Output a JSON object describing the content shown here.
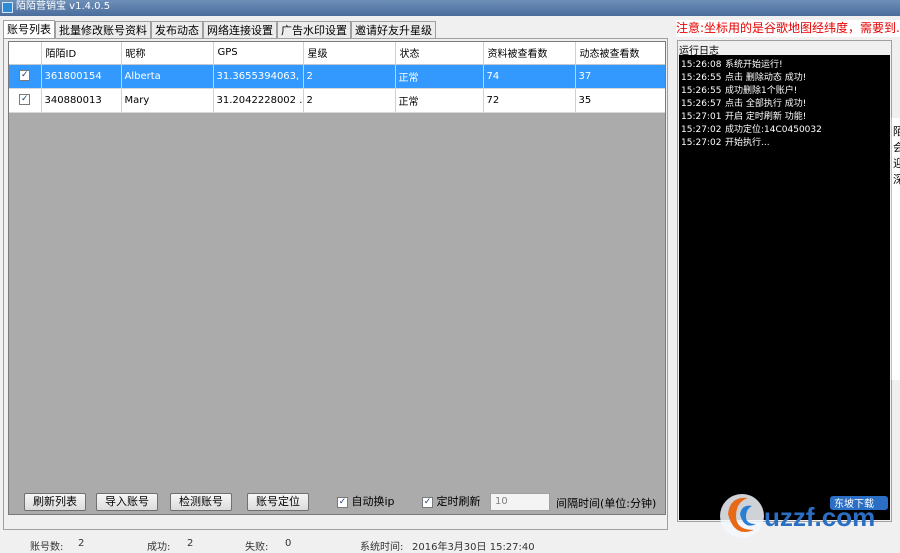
{
  "window": {
    "title": "陌陌营销宝 v1.4.0.5"
  },
  "tabs": [
    "账号列表",
    "批量修改账号资料",
    "发布动态",
    "网络连接设置",
    "广告水印设置",
    "邀请好友升星级"
  ],
  "notice": "注意:坐标用的是谷歌地图经纬度，需要到...",
  "table": {
    "headers": [
      "",
      "陌陌ID",
      "昵称",
      "GPS",
      "星级",
      "状态",
      "资料被查看数",
      "动态被查看数"
    ],
    "rows": [
      {
        "checked": true,
        "selected": true,
        "cells": [
          "361800154",
          "Alberta",
          "31.3655394063, ...",
          "2",
          "正常",
          "74",
          "37"
        ]
      },
      {
        "checked": true,
        "selected": false,
        "cells": [
          "340880013",
          "Mary",
          "31.2042228002 ...",
          "2",
          "正常",
          "72",
          "35"
        ]
      }
    ]
  },
  "controls": {
    "refresh_label": "刷新列表",
    "import_label": "导入账号",
    "check_label": "检测账号",
    "locate_label": "账号定位",
    "auto_switch_label": "自动换ip",
    "auto_switch_checked": true,
    "timed_refresh_label": "定时刷新",
    "timed_refresh_checked": true,
    "interval_value": "10",
    "interval_label": "间隔时间(单位:分钟)"
  },
  "log": {
    "title": "运行日志",
    "entries": [
      {
        "time": "15:26:08",
        "msg": "系统开始运行!"
      },
      {
        "time": "15:26:55",
        "msg": "点击 删除动态 成功!"
      },
      {
        "time": "15:26:55",
        "msg": "成功删除1个账户!"
      },
      {
        "time": "15:26:57",
        "msg": "点击 全部执行 成功!"
      },
      {
        "time": "15:27:01",
        "msg": "开启 定时刷新 功能!"
      },
      {
        "time": "15:27:02",
        "msg": "成功定位:14C0450032"
      },
      {
        "time": "15:27:02",
        "msg": "开始执行..."
      }
    ]
  },
  "popup_glyphs": [
    "陌",
    "会",
    "迎",
    "深"
  ],
  "status": {
    "accounts_label": "账号数:",
    "accounts_value": "2",
    "success_label": "成功:",
    "success_value": "2",
    "fail_label": "失败:",
    "fail_value": "0",
    "time_label": "系统时间:",
    "time_value": "2016年3月30日 15:27:40"
  },
  "watermark": {
    "text": "uzzf.com",
    "sub": "东坡下载"
  },
  "colors": {
    "selection": "#3399ff",
    "notice": "#e60000",
    "log_bg": "#000000",
    "grid_bg": "#ababab"
  }
}
